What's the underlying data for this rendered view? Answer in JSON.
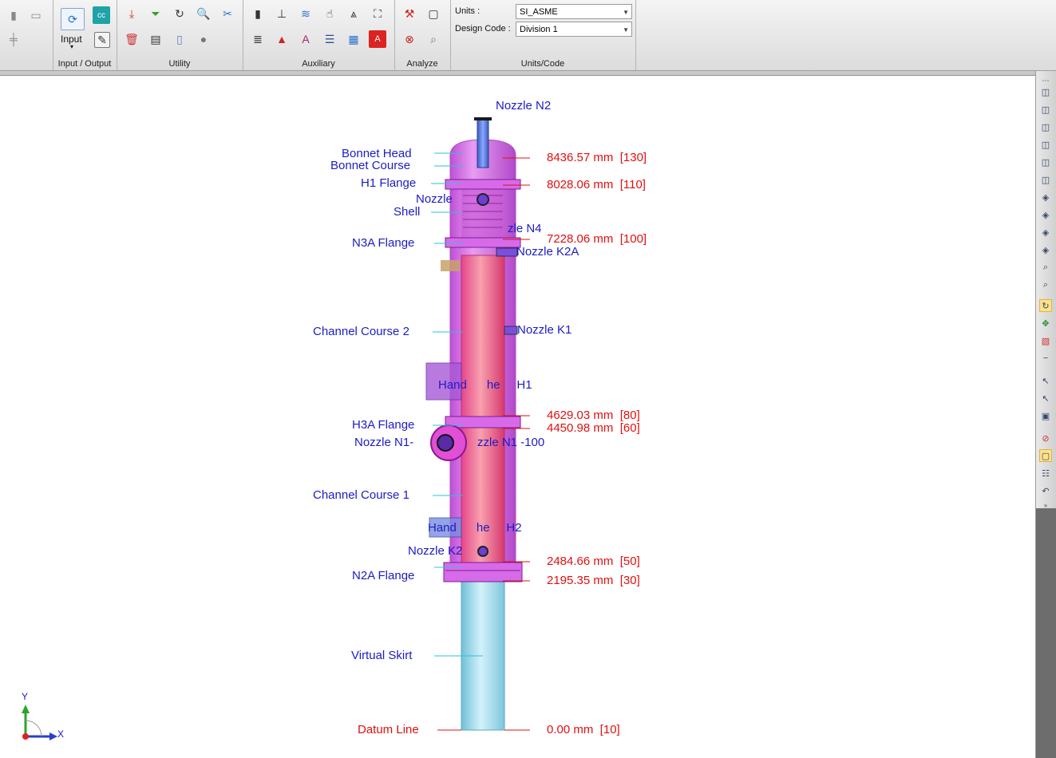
{
  "ribbon": {
    "groups": {
      "input_output": "Input / Output",
      "utility": "Utility",
      "auxiliary": "Auxiliary",
      "analyze": "Analyze",
      "units_code": "Units/Code"
    },
    "input_button": "Input",
    "units_label": "Units :",
    "units_value": "SI_ASME",
    "code_label": "Design Code :",
    "code_value": "Division 1"
  },
  "component_labels": {
    "nozzle_n2": "Nozzle N2",
    "bonnet_head": "Bonnet Head",
    "bonnet_course": "Bonnet Course",
    "h1_flange": "H1 Flange",
    "nozzle": "Nozzle",
    "shell": "Shell",
    "nozzle_n4": "zle N4",
    "n3a_flange": "N3A Flange",
    "nozzle_k2a": "Nozzle K2A",
    "channel_course_2": "Channel Course 2",
    "nozzle_k1": "Nozzle K1",
    "handhole_h1": "Hand      he     H1",
    "h3a_flange": "H3A Flange",
    "nozzle_n1_left": "Nozzle N1-",
    "nozzle_n1_right": "zzle N1 -100",
    "channel_course_1": "Channel Course 1",
    "handhole_h2": "Hand      he     H2",
    "nozzle_k2": "Nozzle K2",
    "n2a_flange": "N2A Flange",
    "virtual_skirt": "Virtual Skirt",
    "datum_line": "Datum Line"
  },
  "elevations": [
    {
      "text": "8436.57 mm  [130]"
    },
    {
      "text": "8028.06 mm  [110]"
    },
    {
      "text": "7228.06 mm  [100]"
    },
    {
      "text": "4629.03 mm  [80]"
    },
    {
      "text": "4450.98 mm  [60]"
    },
    {
      "text": "2484.66 mm  [50]"
    },
    {
      "text": "2195.35 mm  [30]"
    },
    {
      "text": "0.00 mm  [10]"
    }
  ],
  "axes": {
    "y": "Y",
    "x": "X"
  },
  "colors": {
    "vessel_jacket": "#c040d8",
    "vessel_core": "#e86a9a",
    "skirt": "#8fd3e6",
    "label_blue": "#1c1cc4",
    "label_red": "#e01010",
    "leader_cyan": "#27c6d8"
  }
}
